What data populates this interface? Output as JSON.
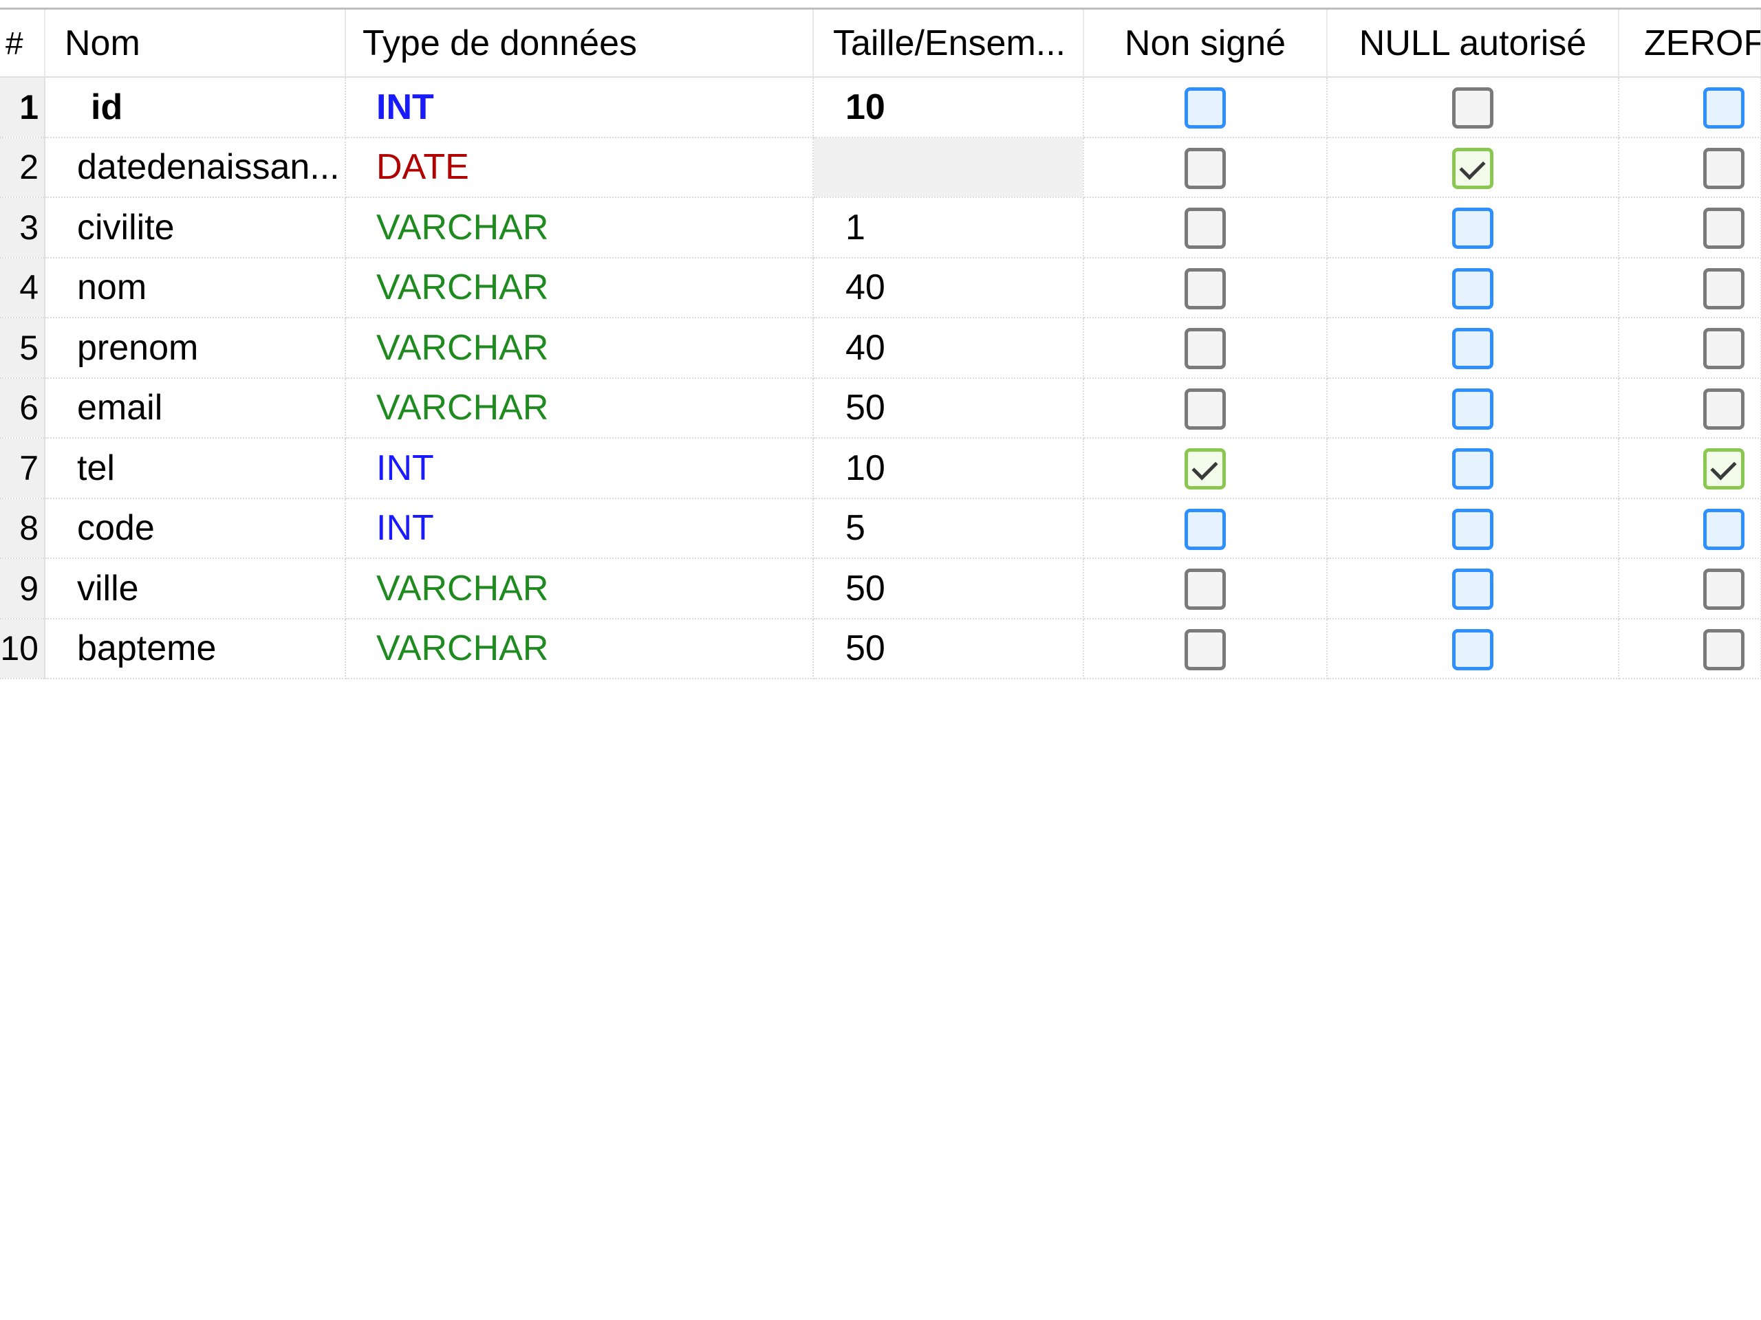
{
  "columns": {
    "num": "#",
    "name": "Nom",
    "type": "Type de données",
    "size": "Taille/Ensem...",
    "unsigned": "Non signé",
    "null": "NULL autorisé",
    "zerofill": "ZEROFIL"
  },
  "rows": [
    {
      "num": "1",
      "name": "id",
      "type": "INT",
      "size": "10",
      "unsigned": "blue",
      "null": "gray",
      "zerofill": "blue"
    },
    {
      "num": "2",
      "name": "datedenaissan...",
      "type": "DATE",
      "size": "",
      "unsigned": "gray",
      "null": "checked",
      "zerofill": "gray"
    },
    {
      "num": "3",
      "name": "civilite",
      "type": "VARCHAR",
      "size": "1",
      "unsigned": "gray",
      "null": "blue",
      "zerofill": "gray"
    },
    {
      "num": "4",
      "name": "nom",
      "type": "VARCHAR",
      "size": "40",
      "unsigned": "gray",
      "null": "blue",
      "zerofill": "gray"
    },
    {
      "num": "5",
      "name": "prenom",
      "type": "VARCHAR",
      "size": "40",
      "unsigned": "gray",
      "null": "blue",
      "zerofill": "gray"
    },
    {
      "num": "6",
      "name": "email",
      "type": "VARCHAR",
      "size": "50",
      "unsigned": "gray",
      "null": "blue",
      "zerofill": "gray"
    },
    {
      "num": "7",
      "name": "tel",
      "type": "INT",
      "size": "10",
      "unsigned": "checked",
      "null": "blue",
      "zerofill": "checked"
    },
    {
      "num": "8",
      "name": "code",
      "type": "INT",
      "size": "5",
      "unsigned": "blue",
      "null": "blue",
      "zerofill": "blue"
    },
    {
      "num": "9",
      "name": "ville",
      "type": "VARCHAR",
      "size": "50",
      "unsigned": "gray",
      "null": "blue",
      "zerofill": "gray"
    },
    {
      "num": "10",
      "name": "bapteme",
      "type": "VARCHAR",
      "size": "50",
      "unsigned": "gray",
      "null": "blue",
      "zerofill": "gray"
    }
  ],
  "colors": {
    "INT": "#1a1aff",
    "DATE": "#b00000",
    "VARCHAR": "#1f8a1f",
    "checkbox_blue": "#2f8fff",
    "checkbox_gray": "#7a7a7a",
    "checkbox_green": "#8ac750"
  }
}
